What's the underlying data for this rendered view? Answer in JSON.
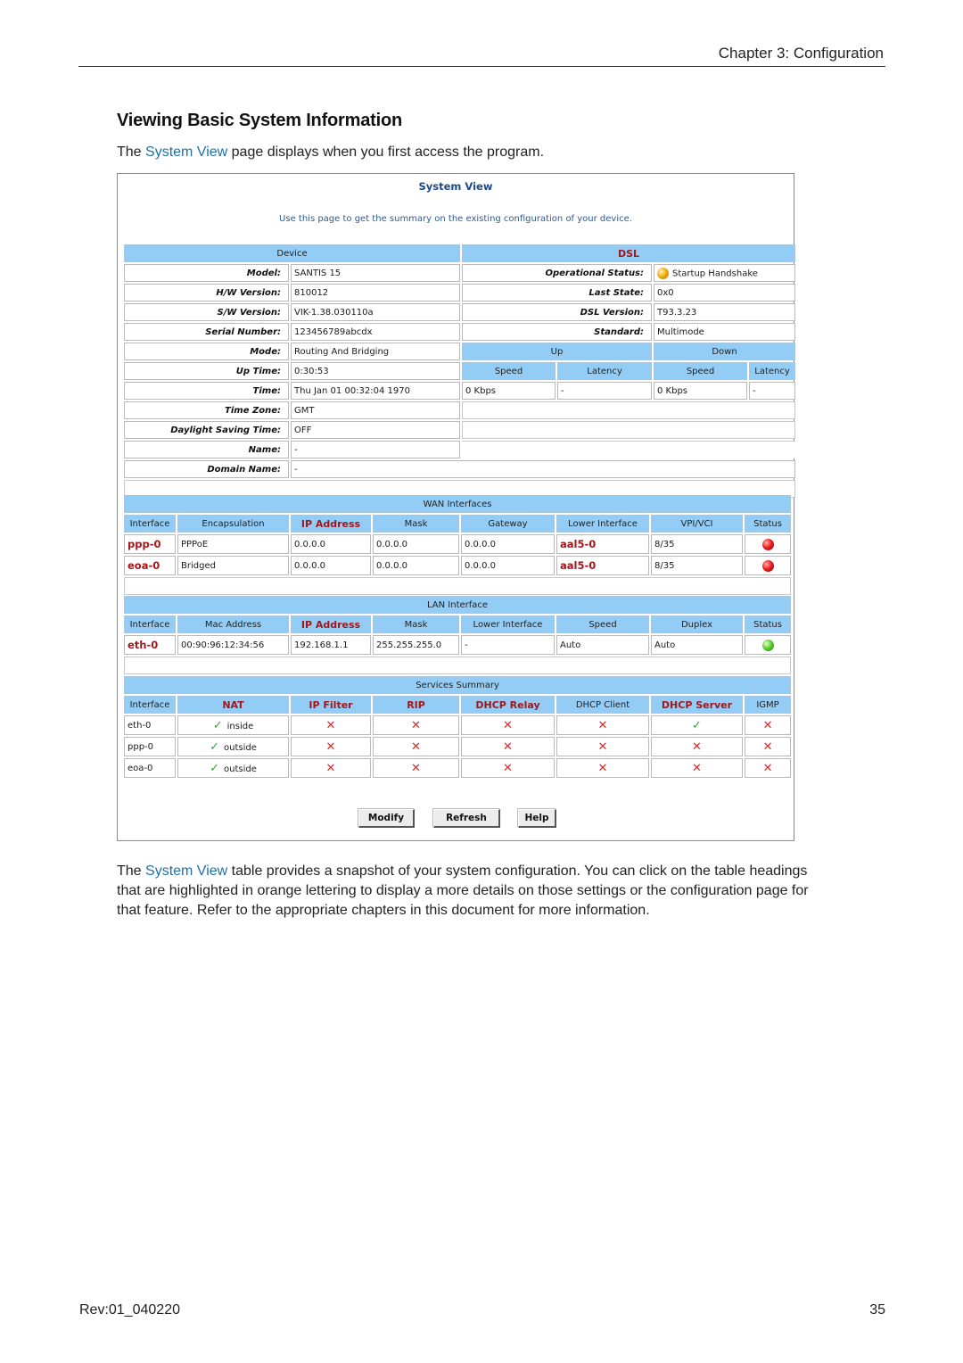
{
  "header": {
    "chapter": "Chapter 3: Configuration"
  },
  "section": {
    "title": "Viewing Basic System Information",
    "intro_prefix": "The ",
    "intro_link": "System View",
    "intro_suffix": " page displays when you first access the program."
  },
  "screenshot": {
    "title": "System View",
    "description": "Use this page to get the summary on the existing configuration of your device.",
    "device": {
      "header": "Device",
      "rows": [
        {
          "label": "Model:",
          "value": "SANTIS 15"
        },
        {
          "label": "H/W Version:",
          "value": "810012"
        },
        {
          "label": "S/W Version:",
          "value": "VIK-1.38.030110a"
        },
        {
          "label": "Serial Number:",
          "value": "123456789abcdx"
        },
        {
          "label": "Mode:",
          "value": "Routing And Bridging"
        },
        {
          "label": "Up Time:",
          "value": "0:30:53"
        },
        {
          "label": "Time:",
          "value": "Thu Jan 01 00:32:04 1970"
        },
        {
          "label": "Time Zone:",
          "value": "GMT"
        },
        {
          "label": "Daylight Saving Time:",
          "value": "OFF"
        },
        {
          "label": "Name:",
          "value": "-"
        },
        {
          "label": "Domain Name:",
          "value": "-"
        }
      ]
    },
    "dsl": {
      "header": "DSL",
      "rows": [
        {
          "label": "Operational Status:",
          "value": "Startup Handshake",
          "status_icon": "yellow"
        },
        {
          "label": "Last State:",
          "value": "0x0"
        },
        {
          "label": "DSL Version:",
          "value": "T93.3.23"
        },
        {
          "label": "Standard:",
          "value": "Multimode"
        }
      ],
      "up_label": "Up",
      "down_label": "Down",
      "speed_label": "Speed",
      "latency_label": "Latency",
      "up_speed": "0 Kbps",
      "up_latency": "-",
      "down_speed": "0 Kbps",
      "down_latency": "-"
    },
    "wan": {
      "header": "WAN Interfaces",
      "columns": [
        "Interface",
        "Encapsulation",
        "IP Address",
        "Mask",
        "Gateway",
        "Lower Interface",
        "VPI/VCI",
        "Status"
      ],
      "rows": [
        {
          "interface": "ppp-0",
          "encapsulation": "PPPoE",
          "ip": "0.0.0.0",
          "mask": "0.0.0.0",
          "gateway": "0.0.0.0",
          "lower": "aal5-0",
          "vpivci": "8/35",
          "status": "red"
        },
        {
          "interface": "eoa-0",
          "encapsulation": "Bridged",
          "ip": "0.0.0.0",
          "mask": "0.0.0.0",
          "gateway": "0.0.0.0",
          "lower": "aal5-0",
          "vpivci": "8/35",
          "status": "red"
        }
      ]
    },
    "lan": {
      "header": "LAN Interface",
      "columns": [
        "Interface",
        "Mac Address",
        "IP Address",
        "Mask",
        "Lower Interface",
        "Speed",
        "Duplex",
        "Status"
      ],
      "rows": [
        {
          "interface": "eth-0",
          "mac": "00:90:96:12:34:56",
          "ip": "192.168.1.1",
          "mask": "255.255.255.0",
          "lower": "-",
          "speed": "Auto",
          "duplex": "Auto",
          "status": "green"
        }
      ]
    },
    "services": {
      "header": "Services Summary",
      "columns": [
        "Interface",
        "NAT",
        "IP Filter",
        "RIP",
        "DHCP Relay",
        "DHCP Client",
        "DHCP Server",
        "IGMP"
      ],
      "check_glyph": "✓",
      "cross_glyph": "✕",
      "rows": [
        {
          "interface": "eth-0",
          "nat": "inside",
          "ip_filter": "no",
          "rip": "no",
          "dhcp_relay": "no",
          "dhcp_client": "no",
          "dhcp_server": "yes",
          "igmp": "no"
        },
        {
          "interface": "ppp-0",
          "nat": "outside",
          "ip_filter": "no",
          "rip": "no",
          "dhcp_relay": "no",
          "dhcp_client": "no",
          "dhcp_server": "no",
          "igmp": "no"
        },
        {
          "interface": "eoa-0",
          "nat": "outside",
          "ip_filter": "no",
          "rip": "no",
          "dhcp_relay": "no",
          "dhcp_client": "no",
          "dhcp_server": "no",
          "igmp": "no"
        }
      ]
    },
    "buttons": {
      "modify": "Modify",
      "refresh": "Refresh",
      "help": "Help"
    }
  },
  "body": {
    "prefix": "The ",
    "link": "System View",
    "text": " table provides a snapshot of your system configuration. You can click on the table headings that are highlighted in orange lettering to display a more details on those settings or the configuration page for that feature. Refer to the appropriate chapters in this document for more information."
  },
  "footer": {
    "revision": "Rev:01_040220",
    "page_number": "35"
  },
  "colors": {
    "header_bg": "#93cdf6",
    "link": "#1f6fa8",
    "orange_heading": "#a3161a",
    "check": "#2fa82f",
    "cross": "#e8222a"
  }
}
